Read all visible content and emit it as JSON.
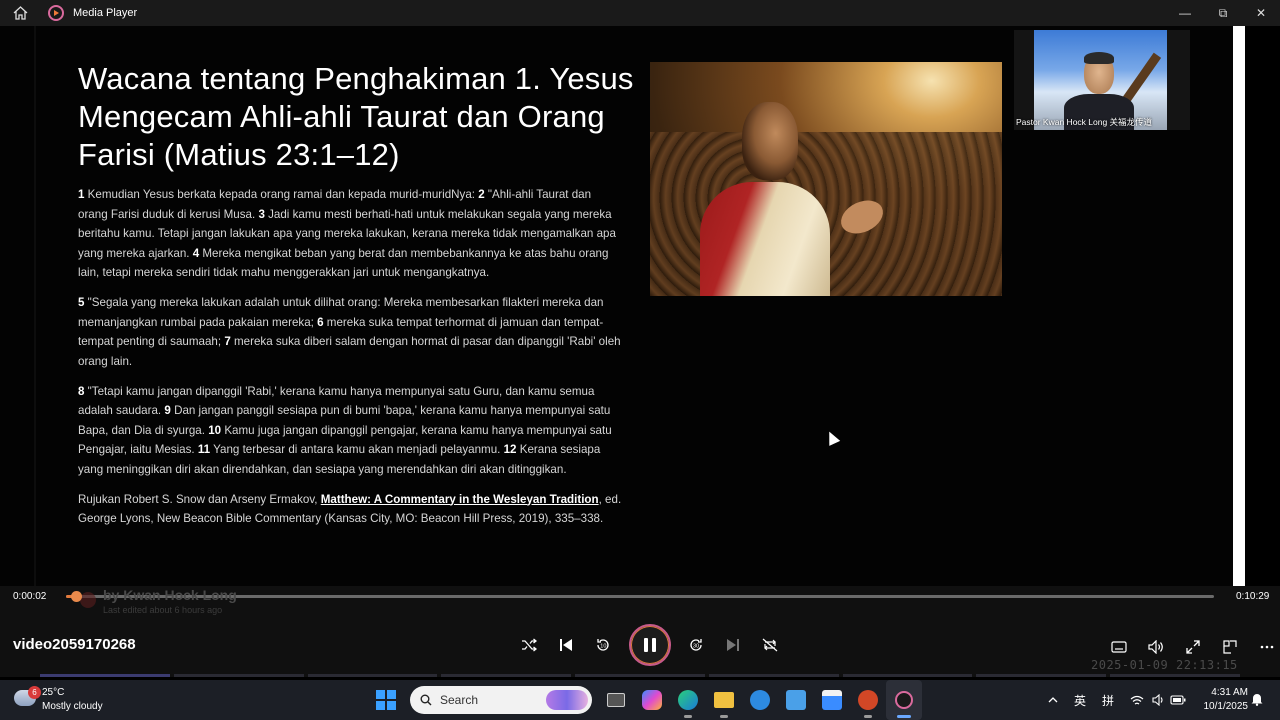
{
  "window": {
    "title": "Media Player"
  },
  "slide": {
    "title": "Wacana tentang Penghakiman 1. Yesus Mengecam Ahli-ahli Taurat dan Orang Farisi (Matius 23:1–12)",
    "p1": [
      {
        "n": "1",
        "t": " Kemudian Yesus berkata kepada orang ramai dan kepada murid-muridNya: "
      },
      {
        "n": "2",
        "t": " \"Ahli-ahli Taurat dan orang Farisi duduk di kerusi Musa. "
      },
      {
        "n": "3",
        "t": " Jadi kamu mesti berhati-hati untuk melakukan segala yang mereka beritahu kamu. Tetapi jangan lakukan apa yang mereka lakukan, kerana mereka tidak mengamalkan apa yang mereka ajarkan. "
      },
      {
        "n": "4",
        "t": " Mereka mengikat beban yang berat dan membebankannya ke atas bahu orang lain, tetapi mereka sendiri tidak mahu menggerakkan jari untuk mengangkatnya."
      }
    ],
    "p2": [
      {
        "n": "5",
        "t": " \"Segala yang mereka lakukan adalah untuk dilihat orang: Mereka membesarkan filakteri mereka dan memanjangkan rumbai pada pakaian mereka; "
      },
      {
        "n": "6",
        "t": " mereka suka tempat terhormat di jamuan dan tempat-tempat penting di saumaah; "
      },
      {
        "n": "7",
        "t": " mereka suka diberi salam dengan hormat di pasar dan dipanggil 'Rabi' oleh orang lain."
      }
    ],
    "p3": [
      {
        "n": "8",
        "t": " \"Tetapi kamu jangan dipanggil 'Rabi,' kerana kamu hanya mempunyai satu Guru, dan kamu semua adalah saudara. "
      },
      {
        "n": "9",
        "t": " Dan jangan panggil sesiapa pun di bumi 'bapa,' kerana kamu hanya mempunyai satu Bapa, dan Dia di syurga. "
      },
      {
        "n": "10",
        "t": " Kamu juga jangan dipanggil pengajar, kerana kamu hanya mempunyai satu Pengajar, iaitu Mesias. "
      },
      {
        "n": "11",
        "t": " Yang terbesar di antara kamu akan menjadi pelayanmu. "
      },
      {
        "n": "12",
        "t": " Kerana sesiapa yang meninggikan diri akan direndahkan, dan sesiapa yang merendahkan diri akan ditinggikan."
      }
    ],
    "ref_pre": "Rujukan Robert S. Snow dan Arseny Ermakov, ",
    "ref_title": "Matthew: A Commentary in the Wesleyan Tradition",
    "ref_post": ", ed. George Lyons, New Beacon Bible Commentary (Kansas City, MO: Beacon Hill Press, 2019), 335–338."
  },
  "webcam": {
    "label": "Pastor Kwan Hock Long 关福龙传道"
  },
  "player": {
    "time_current": "0:00:02",
    "time_total": "0:10:29",
    "progress_fraction": 0.003,
    "ghost_name": "by Kwan Hock Long",
    "ghost_edited": "Last edited about 6 hours ago",
    "video_name": "video2059170268",
    "datestamp": "2025-01-09 22:13:15",
    "controls": [
      "shuffle-icon",
      "previous-icon",
      "rewind-10-icon",
      "pause-icon",
      "forward-30-icon",
      "next-icon",
      "repeat-off-icon"
    ],
    "right_controls": [
      "subtitles-icon",
      "volume-icon",
      "fullscreen-icon",
      "miniplayer-icon",
      "more-icon"
    ]
  },
  "taskbar": {
    "weather_badge": "6",
    "temperature": "25°C",
    "condition": "Mostly cloudy",
    "search_placeholder": "Search",
    "ime1": "英",
    "ime2": "拼",
    "time": "4:31 AM",
    "date": "10/1/2025"
  },
  "colors": {
    "accent": "#e37a3c",
    "accent2": "#c65a8a",
    "taskbar": "#1c1f26"
  }
}
